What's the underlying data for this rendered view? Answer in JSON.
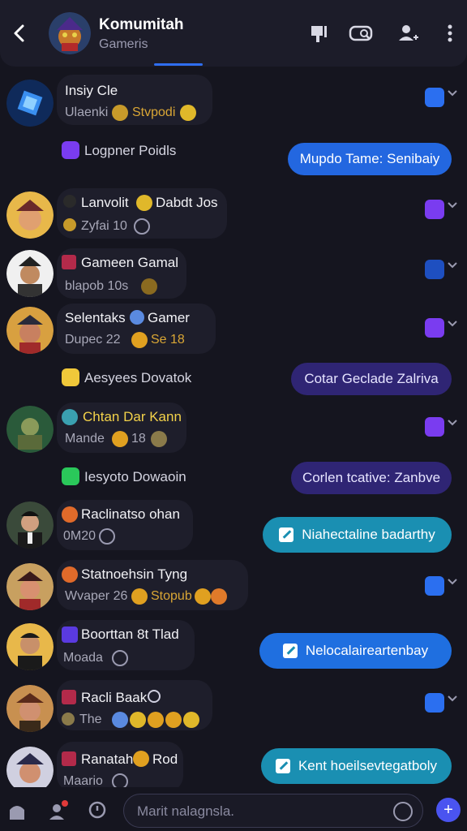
{
  "header": {
    "title": "Komumitah",
    "subtitle": "Gameris"
  },
  "rows": [
    {
      "type": "user",
      "name": "Insiy Cle",
      "sub": "Ulaenki",
      "sub2": "Stvpodi"
    },
    {
      "type": "system",
      "label": "Logpner Poidls",
      "pill": "Mupdo Tame: Senibaiy"
    },
    {
      "type": "user",
      "name": "Lanvolit",
      "name2": "Dabdt Jos",
      "sub": "Zyfai 10"
    },
    {
      "type": "user",
      "name": "Gameen Gamal",
      "sub": "blapob 10s"
    },
    {
      "type": "user",
      "name": "Selentaks",
      "name2": "Gamer",
      "sub": "Dupec 22",
      "sub2": "Se 18"
    },
    {
      "type": "system",
      "label": "Aesyees Dovatok",
      "pill": "Cotar Geclade Zalriva"
    },
    {
      "type": "user",
      "name": "Chtan Dar Kann",
      "sub": "Mande",
      "sub2": "18"
    },
    {
      "type": "system",
      "label": "Iesyoto Dowaoin",
      "pill": "Corlen tcative: Zanbve"
    },
    {
      "type": "user",
      "name": "Raclinatso ohan",
      "sub": "0M20",
      "pill": "Niahectaline badarthy"
    },
    {
      "type": "user",
      "name": "Statnoehsin Tyng",
      "sub": "Wvaper 26",
      "sub2": "Stopub"
    },
    {
      "type": "user",
      "name": "Boorttan 8t Tlad",
      "sub": "Moada",
      "pill": "Nelocalaireartenbay"
    },
    {
      "type": "user",
      "name": "Racli Baak",
      "sub": "The"
    },
    {
      "type": "user",
      "name": "Ranatah",
      "name2": "Rod",
      "sub": "Maario",
      "pill": "Kent hoeilsevtegatboly"
    }
  ],
  "composer": {
    "placeholder": "Marit nalagnsla."
  },
  "colors": {
    "accent": "#2367e0",
    "purple_pill": "#2f2574",
    "teal_pill": "#1a8fb2",
    "check_blue": "#2b6ff0",
    "check_purple": "#7a3cf0"
  }
}
